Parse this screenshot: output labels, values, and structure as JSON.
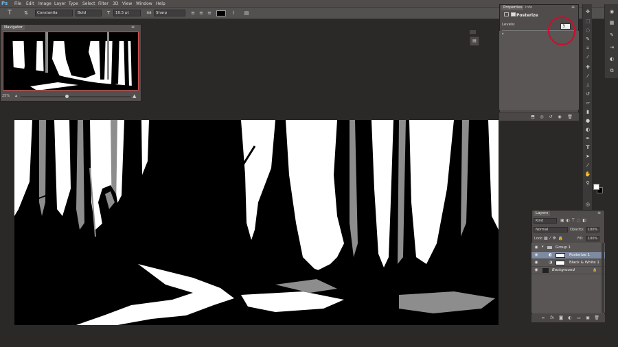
{
  "app_logo": "Ps",
  "menu": [
    "File",
    "Edit",
    "Image",
    "Layer",
    "Type",
    "Select",
    "Filter",
    "3D",
    "View",
    "Window",
    "Help"
  ],
  "options_bar": {
    "tool_icon": "T",
    "orient_icon": "⇅",
    "font_family": "Constantia",
    "font_style": "Bold",
    "size_icon": "T",
    "font_size": "10.5 pt",
    "aa_icon": "aa",
    "antialias": "Sharp",
    "text_color": "#000000"
  },
  "navigator": {
    "tabs": [
      "Navigator"
    ],
    "zoom": "25%"
  },
  "properties": {
    "tabs": [
      "Properties",
      "Info"
    ],
    "title": "Posterize",
    "levels_label": "Levels:",
    "levels_value": "3",
    "highlight_color": "#c8102e"
  },
  "layers": {
    "tabs": [
      "Layers"
    ],
    "filter_kind": "Kind",
    "blend_mode": "Normal",
    "opacity_label": "Opacity:",
    "opacity": "100%",
    "lock_label": "Lock:",
    "fill_label": "Fill:",
    "fill": "100%",
    "rows": [
      {
        "name": "Group 1",
        "type": "group",
        "selected": false
      },
      {
        "name": "Posterize 1",
        "type": "adjustment",
        "selected": true
      },
      {
        "name": "Black & White 1",
        "type": "adjustment",
        "selected": false
      },
      {
        "name": "Background",
        "type": "image",
        "selected": false
      }
    ]
  },
  "colors": {
    "foreground": "#ffffff",
    "background": "#000000",
    "ui_dark": "#2b2928",
    "panel": "#4f4c4b",
    "selection": "#7d8aa0"
  }
}
